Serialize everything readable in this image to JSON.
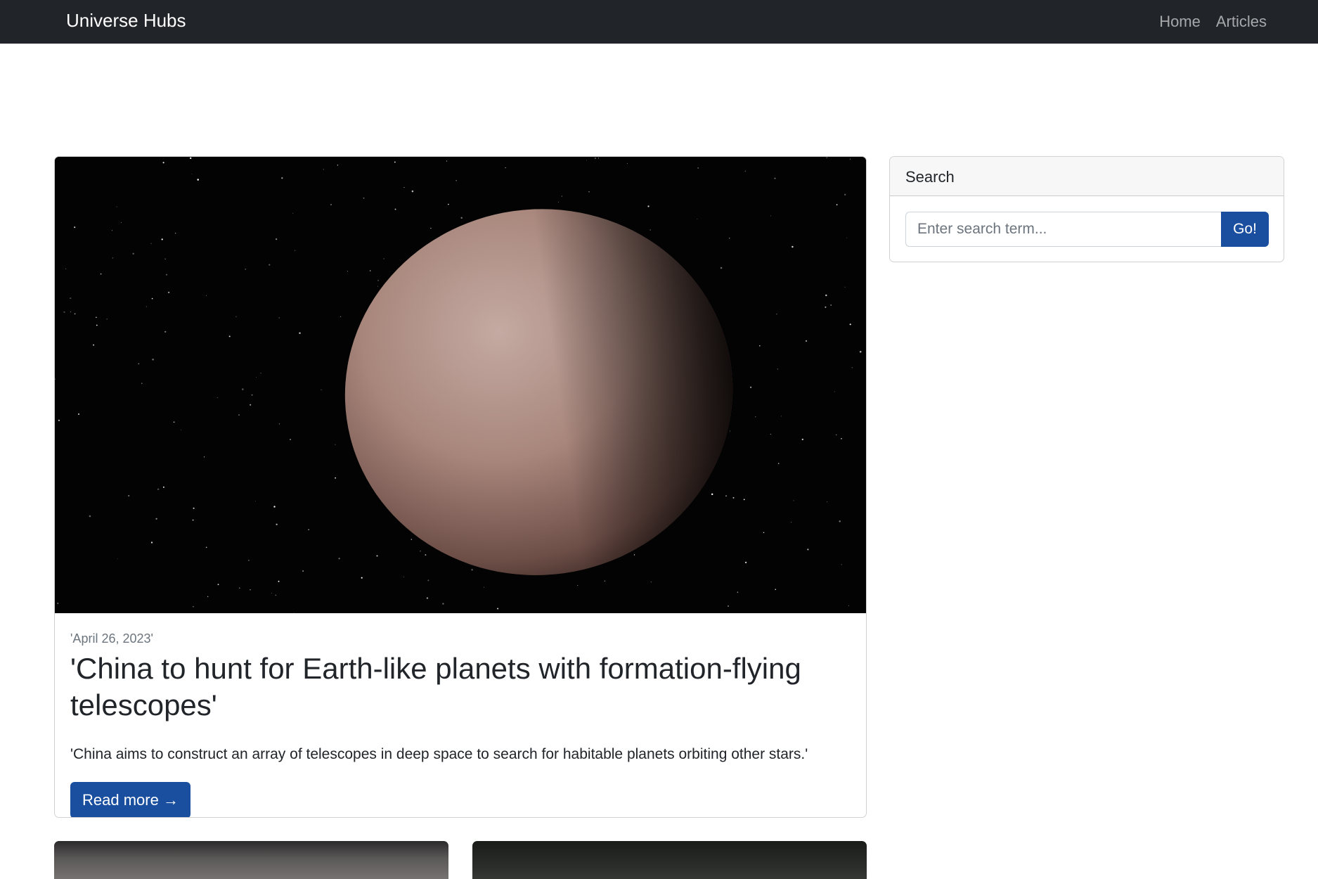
{
  "navbar": {
    "brand": "Universe Hubs",
    "links": [
      "Home",
      "Articles"
    ]
  },
  "featured_post": {
    "date": "'April 26, 2023'",
    "title": "'China to hunt for Earth-like planets with formation-flying telescopes'",
    "excerpt": "'China aims to construct an array of telescopes in deep space to search for habitable planets orbiting other stars.'",
    "read_more_label": "Read more →"
  },
  "sidebar": {
    "search": {
      "heading": "Search",
      "placeholder": "Enter search term...",
      "button_label": "Go!"
    }
  },
  "colors": {
    "navbar_bg": "#212529",
    "primary_button": "#1a4fa0"
  }
}
